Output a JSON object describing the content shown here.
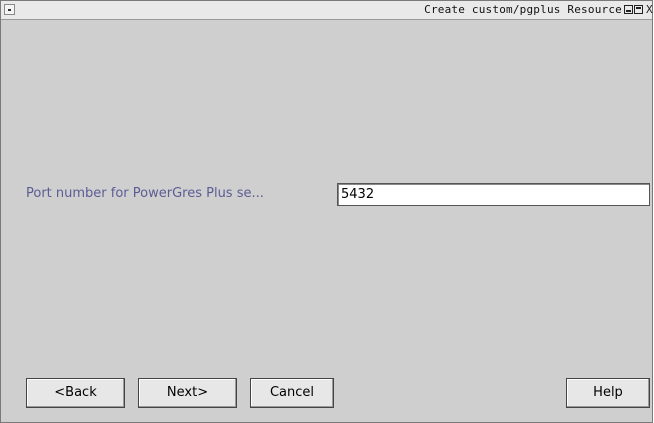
{
  "window": {
    "title": "Create custom/pgplus Resource",
    "close_glyph": "X"
  },
  "form": {
    "port_label": "Port number for PowerGres Plus se...",
    "port_value": "5432"
  },
  "buttons": {
    "back": "<Back",
    "next": "Next>",
    "cancel": "Cancel",
    "help": "Help"
  },
  "colors": {
    "background": "#cfcfcf",
    "label": "#5c5c95",
    "titlebar": "#e9e9e9"
  }
}
